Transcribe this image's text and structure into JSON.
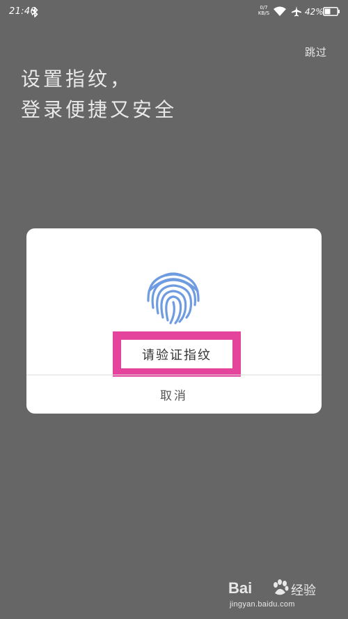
{
  "status_bar": {
    "time": "21:46",
    "net_rate_value": "0/7",
    "net_rate_unit": "KB/S",
    "battery": "42%",
    "icons": [
      "bluetooth-icon",
      "wifi-icon",
      "airplane-mode-icon",
      "battery-icon"
    ]
  },
  "header": {
    "skip_label": "跳过",
    "headline_line1": "设置指纹，",
    "headline_line2": "登录便捷又安全"
  },
  "dialog": {
    "icon": "fingerprint-icon",
    "icon_color": "#6f9be0",
    "prompt": "请验证指纹",
    "highlight_color": "#e5449d",
    "cancel_label": "取消"
  },
  "watermark": {
    "logo_text": "Bai",
    "logo_suffix": "经验",
    "url": "jingyan.baidu.com"
  }
}
